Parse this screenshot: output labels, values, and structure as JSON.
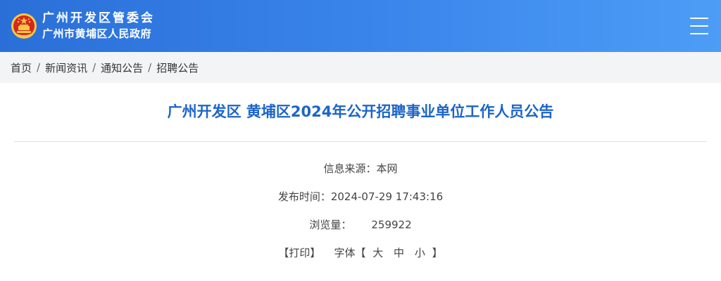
{
  "header": {
    "org_line1": "广州开发区管委会",
    "org_line2": "广州市黄埔区人民政府",
    "emblem_icon": "national-emblem-icon",
    "menu_icon": "hamburger-menu-icon",
    "colors": {
      "header_blue": "#3a86ec",
      "title_blue": "#1c64c8",
      "emblem_red": "#d7261e",
      "emblem_gold": "#f6c945"
    }
  },
  "breadcrumb": {
    "items": [
      "首页",
      "新闻资讯",
      "通知公告",
      "招聘公告"
    ],
    "separator": "/"
  },
  "article": {
    "title": "广州开发区 黄埔区2024年公开招聘事业单位工作人员公告",
    "source_label": "信息来源：",
    "source_value": "本网",
    "time_label": "发布时间：",
    "time_value": "2024-07-29 17:43:16",
    "views_label": "浏览量：",
    "views_value": "259922",
    "print_label": "【打印】",
    "font_label": "字体【",
    "font_large": "大",
    "font_medium": "中",
    "font_small": "小",
    "font_close": "】"
  }
}
